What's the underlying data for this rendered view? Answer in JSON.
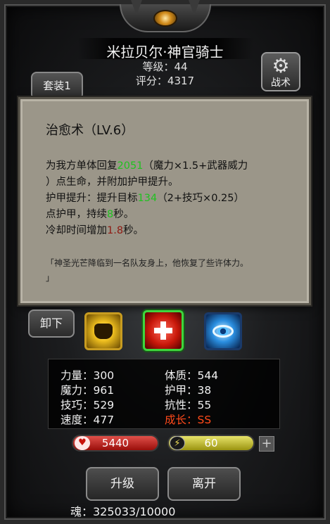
{
  "header": {
    "name": "米拉贝尔·神官骑士",
    "level": "等级：44",
    "score": "评分：4317"
  },
  "tabs": {
    "set_tab": "套装1",
    "skill_tab": "战术",
    "skill_tab_icon": "gear-icon"
  },
  "tooltip": {
    "title": "治愈术（LV.6）",
    "line1_a": "为我方单体回复",
    "line1_num": "2051",
    "line1_b": "（魔力×1.5+武器威力",
    "line2": "）点生命，并附加护甲提升。",
    "line3_a": "护甲提升：提升目标",
    "line3_num": "134",
    "line3_b": "（2+技巧×0.25）",
    "line4_a": "点护甲，持续",
    "line4_num": "8",
    "line4_b": "秒。",
    "line5_a": "冷却时间增加",
    "line5_num": "1.8",
    "line5_b": "秒。",
    "quote_1": "「神圣光芒降临到一名队友身上，他恢复了些许体力。",
    "quote_2": "」"
  },
  "skills": {
    "unequip": "卸下",
    "icons": [
      "fist-skill-icon",
      "heal-skill-icon",
      "eye-skill-icon"
    ],
    "selected": "heal-skill-icon"
  },
  "stats": {
    "strength": "力量：300",
    "constitution": "体质：544",
    "magic": "魔力：961",
    "armor": "护甲：38",
    "skill": "技巧：529",
    "resistance": "抗性：55",
    "speed": "速度：477",
    "growth": "成长：SS"
  },
  "bars": {
    "hp": "5440",
    "energy": "60"
  },
  "actions": {
    "upgrade": "升级",
    "leave": "离开"
  },
  "soul": "魂：325033/10000",
  "colors": {
    "highlight_green": "#1fc21f",
    "highlight_red": "#8e1a12",
    "growth": "#ff4a1a",
    "hp_bar": "#c8201a",
    "energy_bar": "#d6d040"
  }
}
